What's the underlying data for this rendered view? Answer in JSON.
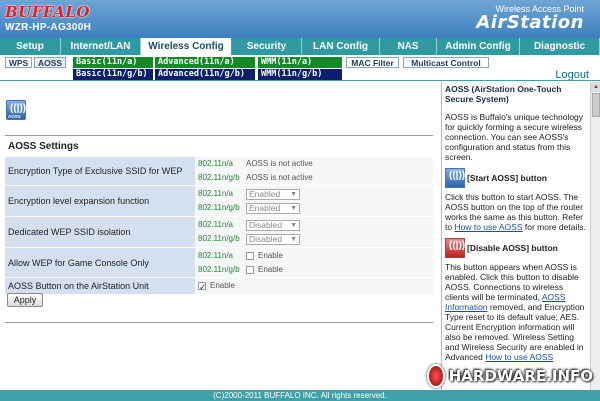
{
  "header": {
    "brand": "BUFFALO",
    "model": "WZR-HP-AG300H",
    "product_sub": "Wireless Access Point",
    "product_main": "AirStation"
  },
  "nav": {
    "tabs": [
      {
        "label": "Setup",
        "active": false
      },
      {
        "label": "Internet/LAN",
        "active": false
      },
      {
        "label": "Wireless Config",
        "active": true
      },
      {
        "label": "Security",
        "active": false
      },
      {
        "label": "LAN Config",
        "active": false
      },
      {
        "label": "NAS",
        "active": false
      },
      {
        "label": "Admin Config",
        "active": false
      },
      {
        "label": "Diagnostic",
        "active": false
      }
    ]
  },
  "subnav": {
    "wps": "WPS",
    "aoss": "AOSS",
    "basic_a": "Basic(11n/a)",
    "basic_g": "Basic(11n/g/b)",
    "adv_a": "Advanced(11n/a)",
    "adv_g": "Advanced(11n/g/b)",
    "wmm_a": "WMM(11n/a)",
    "wmm_g": "WMM(11n/g/b)",
    "mac_filter": "MAC Filter",
    "multicast": "Multicast Control",
    "logout": "Logout"
  },
  "main": {
    "section_title": "AOSS Settings",
    "rows": [
      {
        "label": "Encryption Type of Exclusive SSID for WEP",
        "a_band": "802.11n/a",
        "a_value": "AOSS is not active",
        "g_band": "802.11n/g/b",
        "g_value": "AOSS is not active"
      },
      {
        "label": "Encryption level expansion function",
        "a_band": "802.11n/a",
        "a_value": "Enabled",
        "g_band": "802.11n/g/b",
        "g_value": "Enabled"
      },
      {
        "label": "Dedicated WEP SSID isolation",
        "a_band": "802.11n/a",
        "a_value": "Disabled",
        "g_band": "802.11n/g/b",
        "g_value": "Disabled"
      },
      {
        "label": "Allow WEP for Game Console Only",
        "a_band": "802.11n/a",
        "a_value": "Enable",
        "g_band": "802.11n/g/b",
        "g_value": "Enable"
      },
      {
        "label": "AOSS Button on the AirStation Unit",
        "value": "Enable"
      }
    ],
    "apply_label": "Apply"
  },
  "help": {
    "title": "AOSS (AirStation One-Touch Secure System)",
    "intro": "AOSS is Buffalo's unique technology for quickly forming a secure wireless connection. You can see AOSS's configuration and status from this screen.",
    "start_heading": "[Start AOSS] button",
    "start_text": "Click this button to start AOSS. The AOSS button on the top of the router works the same as this button. Refer to",
    "start_link": "How to use AOSS",
    "start_tail": "for more details.",
    "disable_heading": "[Disable AOSS] button",
    "disable_text1": "This button appears when AOSS is enabled. Click this button to disable AOSS. Connections to wireless clients will be terminated,",
    "disable_link": "AOSS Information",
    "disable_text2": "removed, and Encryption Type reset to its default value; AES. Current Encryption information will also be removed. Wireless Setting and Wireless Security are enabled in Advanced",
    "disable_text3": "How to use AOSS"
  },
  "footer": {
    "copyright": "(C)2000-2011 BUFFALO INC. All rights reserved."
  },
  "watermark": {
    "text": "HARDWARE.INFO"
  },
  "colors": {
    "header_top": "#6fa6d6",
    "nav_teal": "#3ea1a8",
    "band_green": "#23892e",
    "subtab_green": "#138a25",
    "subtab_navy": "#0b1f6e",
    "label_bg": "#d4e0f0"
  }
}
